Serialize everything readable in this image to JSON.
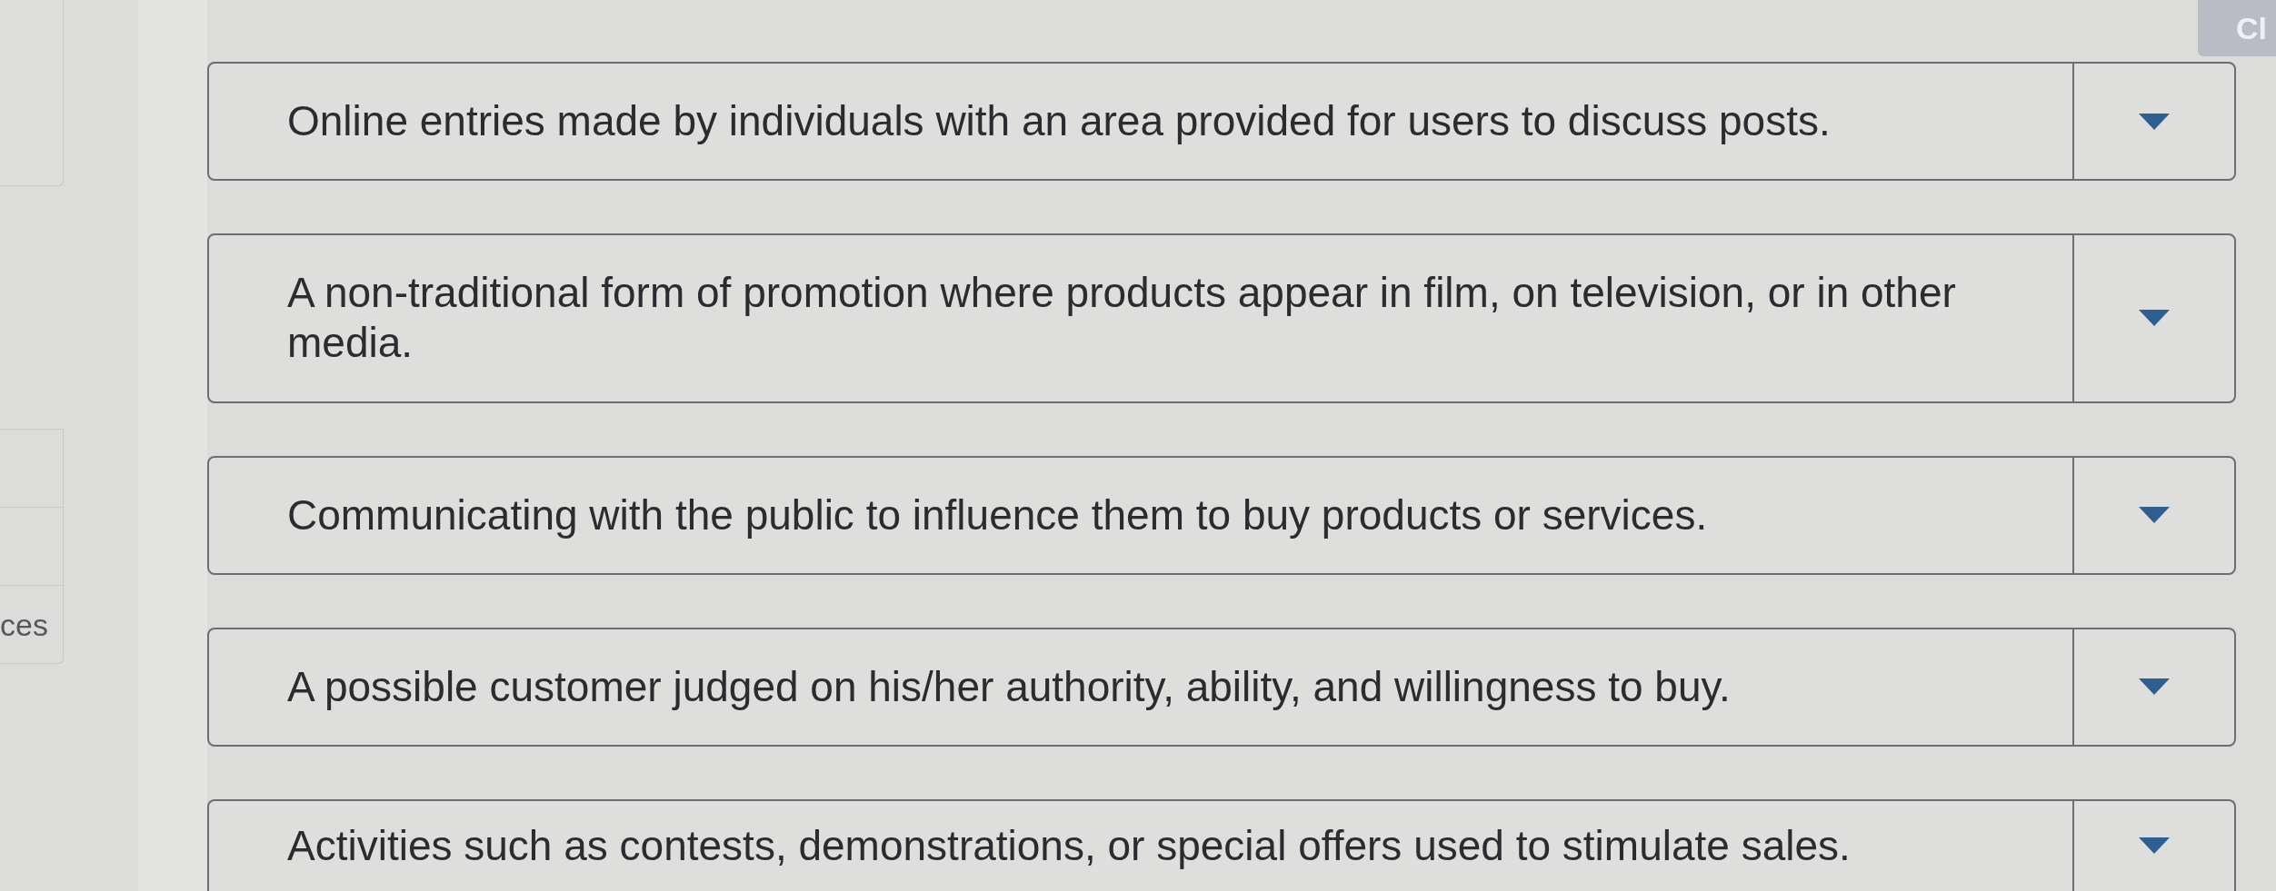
{
  "header_button": {
    "label": "Cl"
  },
  "side_table": {
    "rows": [
      {
        "kind": "blank"
      },
      {
        "kind": "blank"
      },
      {
        "kind": "text",
        "text": "ces"
      }
    ]
  },
  "match_rows": [
    {
      "definition": "Online entries made by individuals with an area provided for users to discuss posts."
    },
    {
      "definition": "A non-traditional form of promotion where products appear in film, on television, or in other media."
    },
    {
      "definition": "Communicating with the public to influence them to buy products or services."
    },
    {
      "definition": "A possible customer judged on his/her authority, ability, and willingness to buy."
    },
    {
      "definition": "Activities such as contests, demonstrations, or special offers used to stimulate sales."
    }
  ]
}
